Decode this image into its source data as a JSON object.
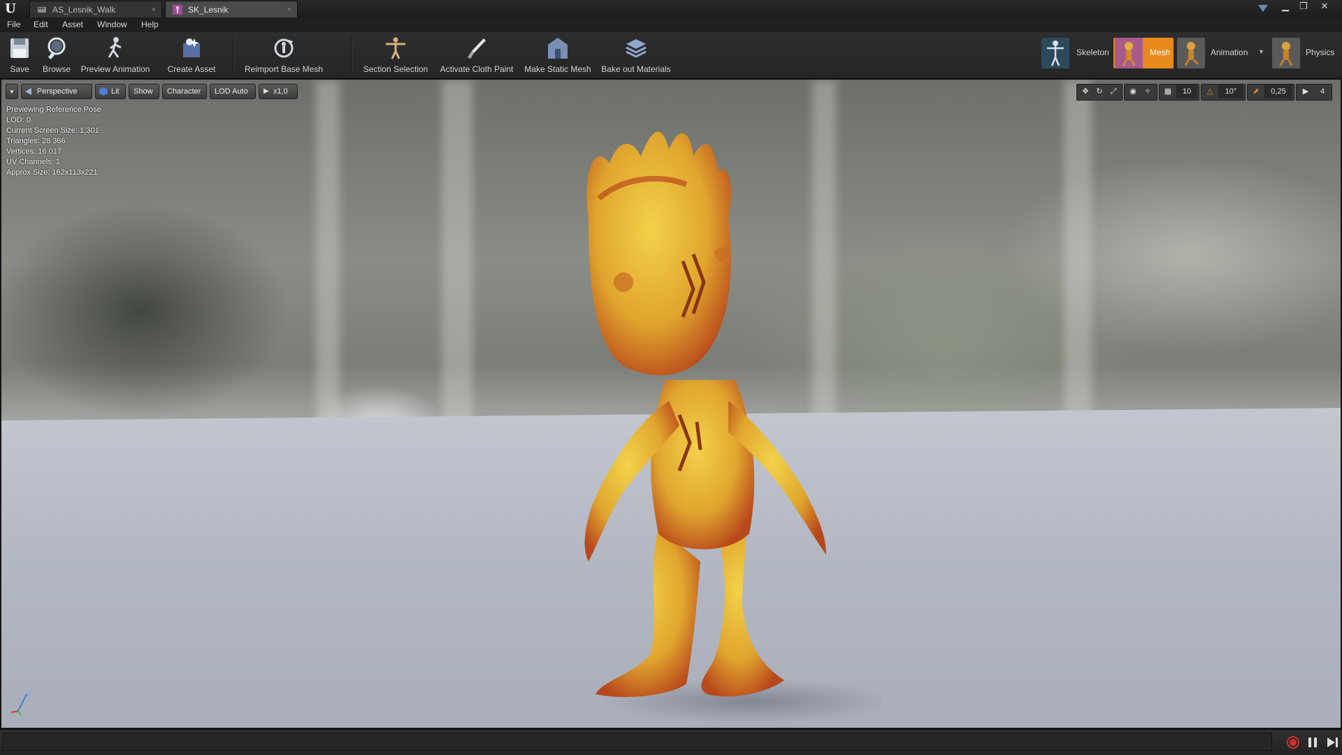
{
  "window": {
    "tabs": [
      {
        "label": "AS_Lesnik_Walk",
        "active": false
      },
      {
        "label": "SK_Lesnik",
        "active": true
      }
    ],
    "controls": [
      "minimize-icon",
      "restore-icon",
      "close-icon"
    ]
  },
  "menu": {
    "items": [
      "File",
      "Edit",
      "Asset",
      "Window",
      "Help"
    ]
  },
  "toolbar": {
    "save": "Save",
    "browse": "Browse",
    "preview_animation": "Preview Animation",
    "create_asset": "Create Asset",
    "reimport_base_mesh": "Reimport Base Mesh",
    "section_selection": "Section Selection",
    "activate_cloth_paint": "Activate Cloth Paint",
    "make_static_mesh": "Make Static Mesh",
    "bake_out_materials": "Bake out Materials"
  },
  "modes": {
    "skeleton": "Skeleton",
    "mesh": "Mesh",
    "animation": "Animation",
    "physics": "Physics",
    "active": "Mesh",
    "accent": "#e8891c"
  },
  "viewport": {
    "buttons": {
      "perspective": "Perspective",
      "lit": "Lit",
      "show": "Show",
      "character": "Character",
      "lod": "LOD Auto",
      "playback": "x1,0"
    },
    "stats": [
      "Previewing Reference Pose",
      "LOD: 0",
      "Current Screen Size: 1,301",
      "Triangles: 28 366",
      "Vertices: 16 017",
      "UV Channels: 1",
      "Approx Size: 162x113x221"
    ],
    "snap": {
      "grid": "10",
      "rotation": "10°",
      "scale": "0,25",
      "camera_speed": "4"
    },
    "axis": {
      "z": "Z"
    }
  },
  "colors": {
    "active_mode": "#e8891c",
    "record": "#d32f2f"
  }
}
